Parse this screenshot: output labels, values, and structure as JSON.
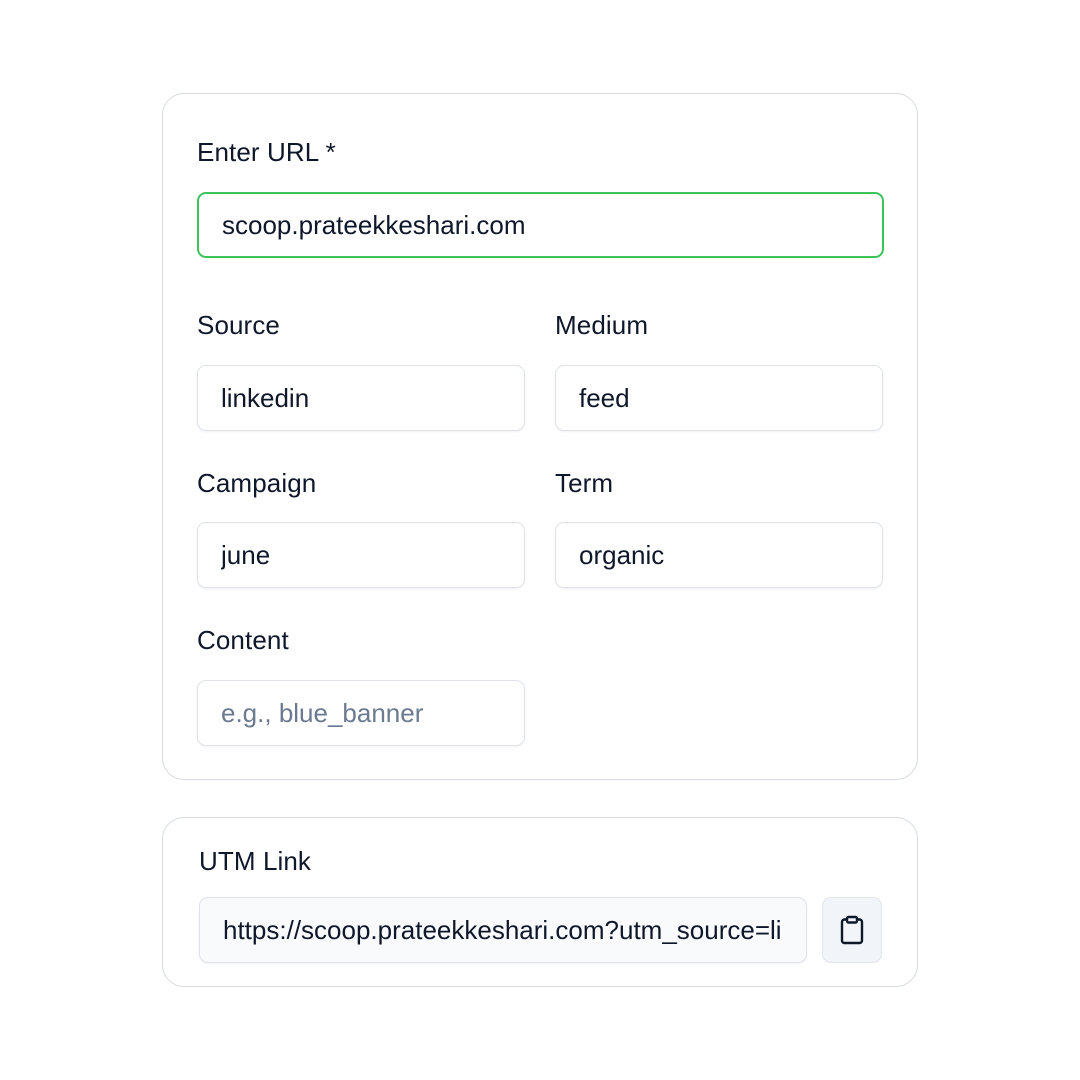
{
  "form": {
    "url": {
      "label": "Enter URL *",
      "value": "scoop.prateekkeshari.com",
      "placeholder": ""
    },
    "source": {
      "label": "Source",
      "value": "linkedin",
      "placeholder": ""
    },
    "medium": {
      "label": "Medium",
      "value": "feed",
      "placeholder": ""
    },
    "campaign": {
      "label": "Campaign",
      "value": "june",
      "placeholder": ""
    },
    "term": {
      "label": "Term",
      "value": "organic",
      "placeholder": ""
    },
    "content": {
      "label": "Content",
      "value": "",
      "placeholder": "e.g., blue_banner"
    }
  },
  "utm": {
    "label": "UTM Link",
    "value": "https://scoop.prateekkeshari.com?utm_source=linkedin&utm_medium=feed&utm_campaign=june&utm_term=organic",
    "copy_icon": "clipboard-icon"
  },
  "colors": {
    "focus_border": "#3cc45a",
    "text": "#0f172a",
    "placeholder": "#6b7a90",
    "card_border": "#d6dae0"
  }
}
